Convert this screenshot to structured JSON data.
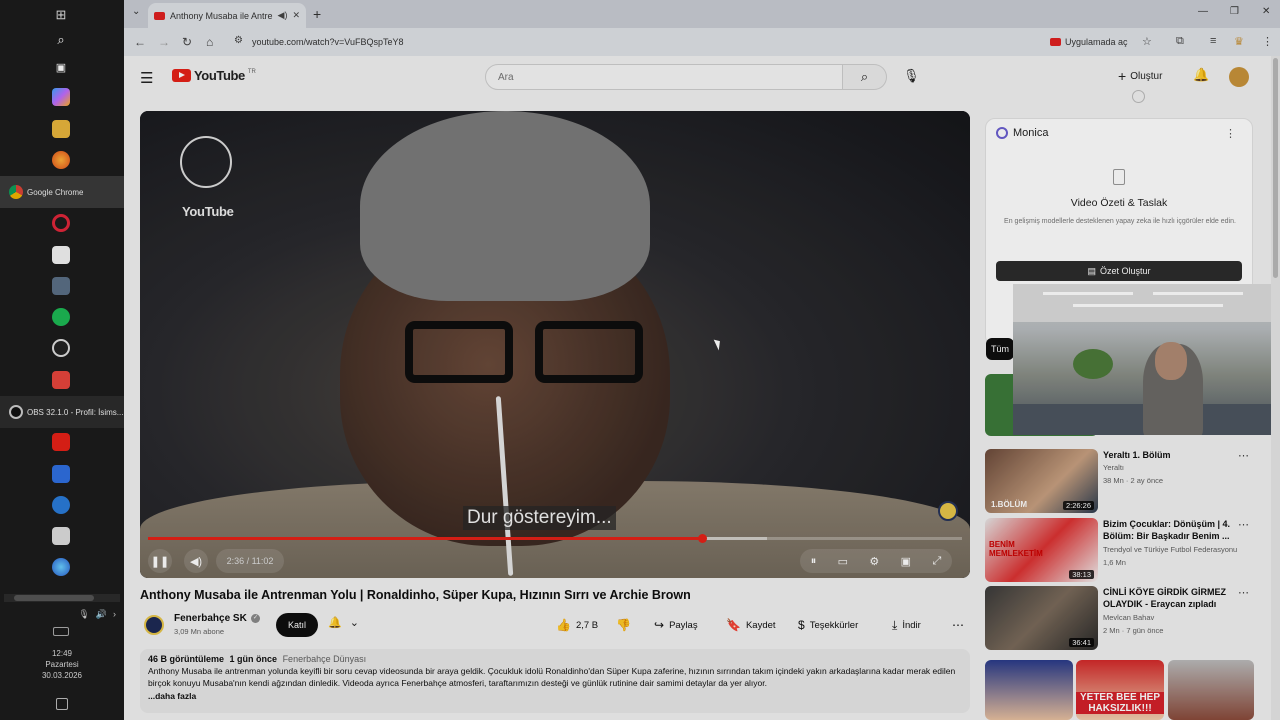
{
  "taskbar": {
    "icons": [
      "windows-icon",
      "search-icon",
      "task-view-icon",
      "copilot-icon",
      "file-explorer-icon",
      "firefox-icon",
      "opera-icon",
      "store-icon",
      "calculator-icon",
      "spotify-icon",
      "obs-icon",
      "anydesk-icon",
      "youtube-icon",
      "meta-icon",
      "edge-icon",
      "capcut-icon",
      "browser-icon"
    ],
    "chrome_label": "Google Chrome",
    "obs_label": "OBS 32.1.0 - Profil: İsims...",
    "clock": {
      "time": "12:49",
      "day": "Pazartesi",
      "date": "30.03.2026"
    }
  },
  "browser": {
    "tab_title": "Anthony Musaba ile Antrenman Yolu",
    "new_tab": "+",
    "url": "youtube.com/watch?v=VuFBQspTeY8",
    "open_in_app": "Uygulamada aç"
  },
  "youtube": {
    "logo": "YouTube",
    "logo_tr": "TR",
    "search_placeholder": "Ara",
    "create_label": "Oluştur"
  },
  "player": {
    "club_text": "YouTube",
    "caption": "Dur göstereyim...",
    "time": "2:36 / 11:02",
    "progress": 0.68,
    "buffered": 0.76
  },
  "video": {
    "title": "Anthony Musaba ile Antrenman Yolu | Ronaldinho, Süper Kupa, Hızının Sırrı ve Archie Brown",
    "channel": "Fenerbahçe SK",
    "subscribers": "3,09 Mn abone",
    "join": "Katıl",
    "likes": "2,7 B",
    "share": "Paylaş",
    "save": "Kaydet",
    "thanks": "Teşekkürler",
    "download": "İndir",
    "views": "46 B görüntüleme",
    "age": "1 gün önce",
    "tag": "Fenerbahçe Dünyası",
    "description": "Anthony Musaba ile antrenman yolunda keyifli bir soru cevap videosunda bir araya geldik. Çocukluk idolü Ronaldinho'dan Süper Kupa zaferine, hızının sırrından takım içindeki yakın arkadaşlarına kadar merak edilen birçok konuyu Musaba'nın kendi ağzından dinledik. Videoda ayrıca Fenerbahçe atmosferi, taraftarımızın desteği ve günlük rutinine dair samimi detaylar da yer alıyor.",
    "more": "...daha fazla"
  },
  "monica": {
    "name": "Monica",
    "heading": "Video Özeti & Taslak",
    "text": "En gelişmiş modellerle desteklenen yapay zeka ile hızlı içgörüler elde edin.",
    "button": "Özet Oluştur"
  },
  "chips": {
    "all": "Tüm"
  },
  "recommendations": [
    {
      "title": "Yeraltı 1. Bölüm",
      "channel": "Yeraltı",
      "meta": "38 Mn · 2 ay önce",
      "duration": "2:26:26",
      "thumb_label": "1.BÖLÜM"
    },
    {
      "title": "Bizim Çocuklar: Dönüşüm | 4. Bölüm: Bir Başkadır Benim ...",
      "channel": "Trendyol ve Türkiye Futbol Federasyonu",
      "meta": "1,6 Mn",
      "duration": "38:13",
      "thumb_label": "BENİM MEMLEKETİM"
    },
    {
      "title": "CİNLİ KÖYE GİRDİK GİRMEZ OLAYDIK - Eraycan zıpladı",
      "channel": "Mevlcan Bahav",
      "meta": "2 Mn · 7 gün önce",
      "duration": "36:41",
      "thumb_label": ""
    }
  ],
  "partial": {
    "caption": "YETER BEE HEP HAKSIZLIK!!!"
  },
  "colors": {
    "accent": "#e62117",
    "dark": "#0f0f0f"
  }
}
